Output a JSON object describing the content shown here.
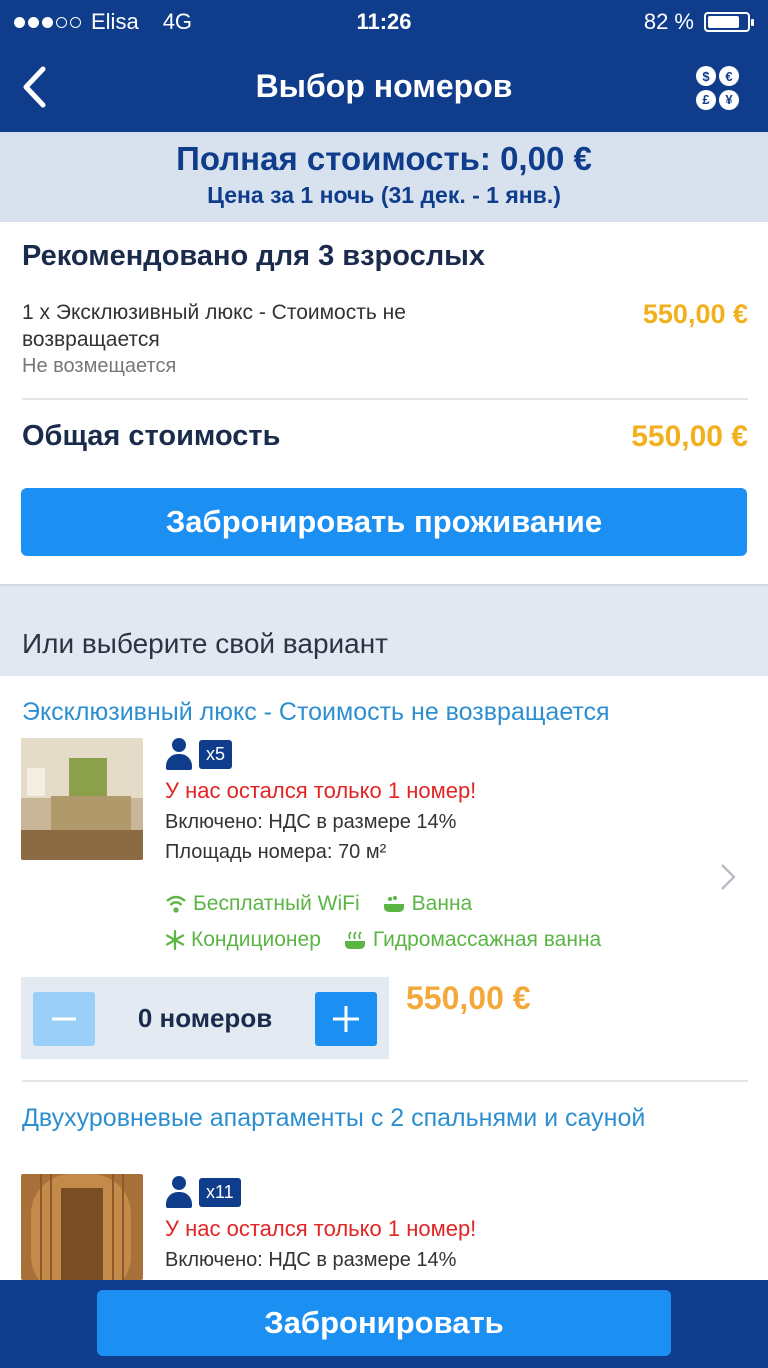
{
  "status_bar": {
    "carrier": "Elisa",
    "network": "4G",
    "time": "11:26",
    "battery": "82 %",
    "battery_level": 0.82
  },
  "nav": {
    "title": "Выбор номеров",
    "back_icon": "chevron-left-icon",
    "currency_icon": "currency-icon"
  },
  "summary": {
    "total": "Полная стоимость: 0,00 €",
    "nights": "Цена за 1 ночь (31 дек. - 1 янв.)"
  },
  "recommended": {
    "heading": "Рекомендовано для 3 взрослых",
    "item": "1 x Эксклюзивный люкс - Стоимость не возвращается",
    "refund": "Не возмещается",
    "item_price": "550,00 €",
    "total_label": "Общая стоимость",
    "total_price": "550,00 €",
    "book_button": "Забронировать проживание"
  },
  "choose": {
    "heading": "Или выберите свой вариант"
  },
  "rooms": [
    {
      "title": "Эксклюзивный люкс - Стоимость не возвращается",
      "guests": "x5",
      "alert": "У нас остался только 1 номер!",
      "vat": "Включено: НДС в размере 14%",
      "area": "Площадь номера: 70 м²",
      "amenities": [
        "Бесплатный WiFi",
        "Ванна",
        "Кондиционер",
        "Гидромассажная ванна"
      ],
      "quantity": "0 номеров",
      "price": "550,00 €"
    },
    {
      "title": "Двухуровневые апартаменты с 2 спальнями и сауной",
      "guests": "x11",
      "alert": "У нас остался только 1 номер!",
      "vat": "Включено: НДС в размере 14%"
    }
  ],
  "bottom": {
    "book_button": "Забронировать"
  },
  "colors": {
    "nav": "#0f3d8c",
    "accent": "#1b8ff2",
    "price": "#f2b01e",
    "alert": "#e12424",
    "amenity": "#5ab544",
    "link": "#2d8fd0"
  }
}
